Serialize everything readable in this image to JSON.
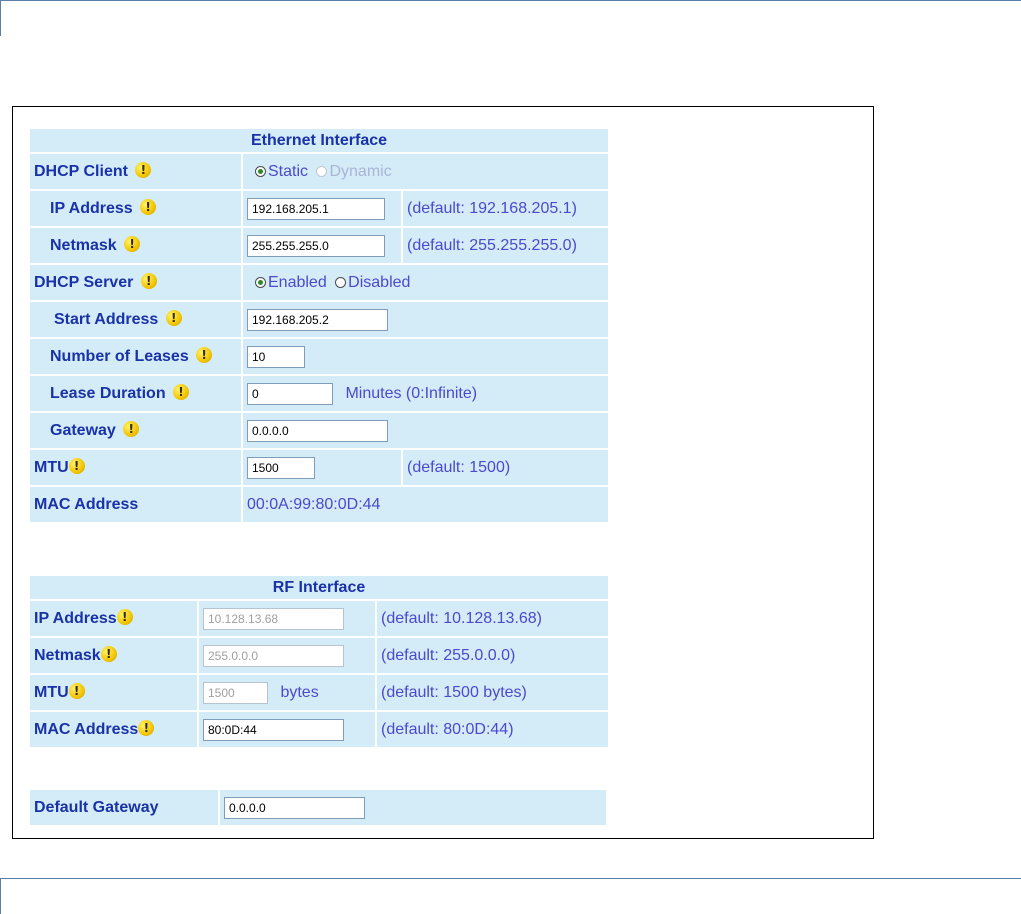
{
  "ethernet": {
    "title": "Ethernet Interface",
    "dhcp_client": {
      "label": "DHCP Client",
      "options": [
        "Static",
        "Dynamic"
      ],
      "selected": "Static"
    },
    "ip_address": {
      "label": "IP Address",
      "value": "192.168.205.1",
      "note": "(default: 192.168.205.1)"
    },
    "netmask": {
      "label": "Netmask",
      "value": "255.255.255.0",
      "note": "(default: 255.255.255.0)"
    },
    "dhcp_server": {
      "label": "DHCP Server",
      "options": [
        "Enabled",
        "Disabled"
      ],
      "selected": "Enabled"
    },
    "start_address": {
      "label": "Start Address",
      "value": "192.168.205.2"
    },
    "number_of_leases": {
      "label": "Number of Leases",
      "value": "10"
    },
    "lease_duration": {
      "label": "Lease Duration",
      "value": "0",
      "note": "Minutes (0:Infinite)"
    },
    "gateway": {
      "label": "Gateway",
      "value": "0.0.0.0"
    },
    "mtu": {
      "label": "MTU",
      "value": "1500",
      "note": "(default: 1500)"
    },
    "mac_address": {
      "label": "MAC Address",
      "value": "00:0A:99:80:0D:44"
    }
  },
  "rf": {
    "title": "RF Interface",
    "ip_address": {
      "label": "IP Address",
      "value": "10.128.13.68",
      "note": "(default: 10.128.13.68)"
    },
    "netmask": {
      "label": "Netmask",
      "value": "255.0.0.0",
      "note": "(default: 255.0.0.0)"
    },
    "mtu": {
      "label": "MTU",
      "value": "1500",
      "unit": "bytes",
      "note": "(default: 1500 bytes)"
    },
    "mac_address": {
      "label": "MAC Address",
      "value": "80:0D:44",
      "note": "(default: 80:0D:44)"
    }
  },
  "default_gateway": {
    "label": "Default Gateway",
    "value": "0.0.0.0"
  },
  "warning_icon_glyph": "!",
  "colors": {
    "cell_bg": "#d4ecf7",
    "label_text": "#1a32a8",
    "value_text": "#4a4acd",
    "warning_icon": "#f2c400"
  }
}
